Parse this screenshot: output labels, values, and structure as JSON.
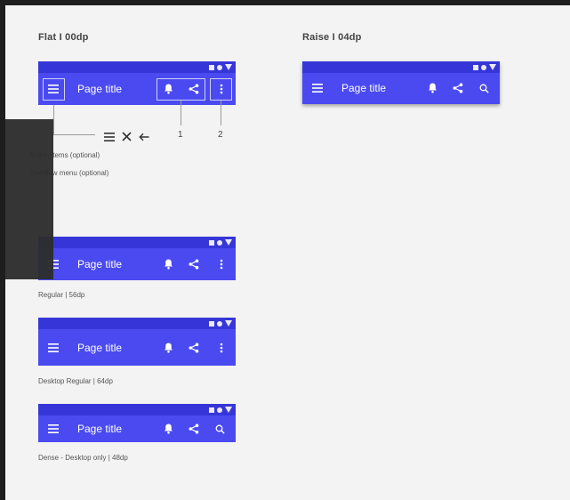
{
  "sections": {
    "flat_title": "Flat  I 00dp",
    "raise_title": "Raise  I 04dp"
  },
  "app_bar": {
    "title": "Page title"
  },
  "annotations": {
    "callout_1": "1",
    "callout_2": "2",
    "action_items": "Action items (optional)",
    "overflow_menu": "Overflow menu (optional)"
  },
  "captions": {
    "regular": "Regular | 56dp",
    "desktop_regular": "Desktop Regular | 64dp",
    "dense": "Dense - Desktop only | 48dp"
  },
  "icons": [
    "menu-icon",
    "bell-icon",
    "share-icon",
    "more-vert-icon",
    "search-icon",
    "close-icon",
    "arrow-back-icon"
  ],
  "colors": {
    "app_bar": "#4a4af0",
    "status_bar": "#3636d8",
    "canvas": "#f3f3f3"
  }
}
